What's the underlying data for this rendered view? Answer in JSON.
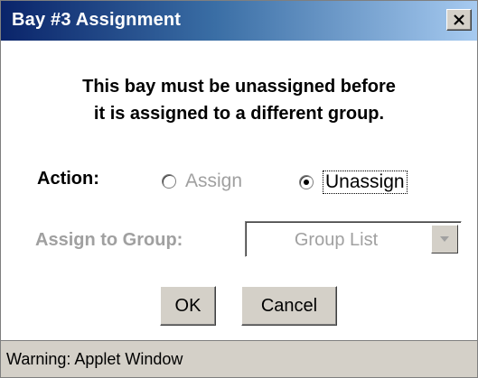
{
  "window": {
    "title": "Bay #3 Assignment"
  },
  "message": {
    "line1": "This bay must be unassigned before",
    "line2": "it is assigned to a different group."
  },
  "action": {
    "label": "Action:",
    "options": [
      {
        "label": "Assign",
        "checked": false,
        "enabled": false
      },
      {
        "label": "Unassign",
        "checked": true,
        "enabled": true
      }
    ]
  },
  "group": {
    "label": "Assign to Group:",
    "select_value": "Group List"
  },
  "buttons": {
    "ok": "OK",
    "cancel": "Cancel"
  },
  "status": {
    "text": "Warning: Applet Window"
  },
  "icons": {
    "close": "close-icon",
    "dropdown": "chevron-down-icon"
  },
  "colors": {
    "titlebar_start": "#0a246a",
    "titlebar_end": "#a6caf0",
    "disabled_text": "#a0a0a0",
    "face": "#d4d0c8"
  }
}
